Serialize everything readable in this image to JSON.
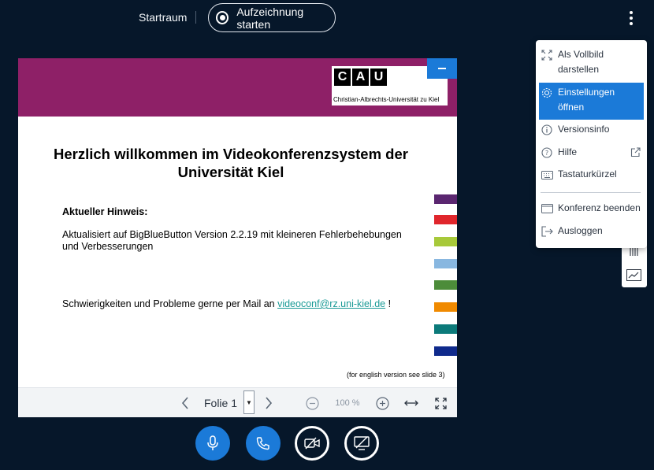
{
  "header": {
    "room_name": "Startraum",
    "record_label": "Aufzeichnung starten"
  },
  "slide": {
    "logo_letters": [
      "C",
      "A",
      "U"
    ],
    "logo_subtitle": "Christian-Albrechts-Universität zu Kiel",
    "title": "Herzlich willkommen im Videokonferenzsystem der Universität Kiel",
    "hint_heading": "Aktueller Hinweis:",
    "hint_text": "Aktualisiert auf BigBlueButton Version 2.2.19 mit kleineren Fehlerbehebungen und Verbesserungen",
    "contact_text": "Schwierigkeiten und Probleme gerne per Mail an",
    "contact_email": "videoconf@rz.uni-kiel.de",
    "contact_suffix": "!",
    "footnote": "(for english version see slide 3)",
    "stripe_colors": [
      "#5a2670",
      "#e0262c",
      "#a7c93a",
      "#88b7e0",
      "#4c8c3a",
      "#f08a00",
      "#0b7a7a",
      "#0f2a8c"
    ]
  },
  "toolbar": {
    "slide_label": "Folie 1",
    "zoom_value": "100 %"
  },
  "menu": {
    "items": [
      {
        "label": "Als Vollbild darstellen",
        "icon": "fullscreen-icon"
      },
      {
        "label": "Einstellungen öffnen",
        "icon": "settings-icon",
        "active": true
      },
      {
        "label": "Versionsinfo",
        "icon": "info-icon"
      },
      {
        "label": "Hilfe",
        "icon": "help-icon"
      },
      {
        "label": "Tastaturkürzel",
        "icon": "keyboard-icon"
      },
      {
        "label": "Konferenz beenden",
        "icon": "end-conference-icon"
      },
      {
        "label": "Ausloggen",
        "icon": "logout-icon"
      }
    ]
  },
  "colors": {
    "background": "#06172a",
    "accent": "#1b7ad8",
    "banner": "#8e2067"
  }
}
